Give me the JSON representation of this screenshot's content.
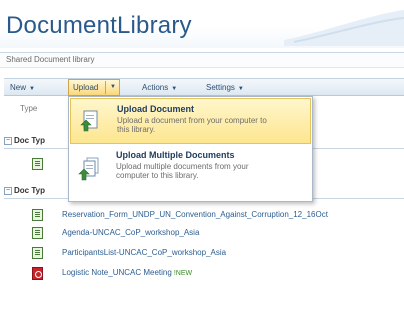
{
  "page_title": "DocumentLibrary",
  "breadcrumb": "Shared Document library",
  "toolbar": {
    "new_label": "New",
    "upload_label": "Upload",
    "actions_label": "Actions",
    "settings_label": "Settings"
  },
  "column_header": "Type",
  "groups": [
    {
      "label": "Doc Typ"
    },
    {
      "label": "Doc Typ"
    }
  ],
  "upload_menu": {
    "items": [
      {
        "title": "Upload Document",
        "description": "Upload a document from your computer to this library.",
        "icon": "upload-document-icon"
      },
      {
        "title": "Upload Multiple Documents",
        "description": "Upload multiple documents from your computer to this library.",
        "icon": "upload-multiple-icon"
      }
    ]
  },
  "documents": [
    {
      "name": "Reservation_Form_UNDP_UN_Convention_Against_Corruption_12_16Oct",
      "icon": "word-document-icon",
      "is_new": false
    },
    {
      "name": "Agenda-UNCAC_CoP_workshop_Asia",
      "icon": "word-document-icon",
      "is_new": false
    },
    {
      "name": "ParticipantsList-UNCAC_CoP_workshop_Asia",
      "icon": "word-document-icon",
      "is_new": false
    },
    {
      "name": "Logistic Note_UNCAC Meeting",
      "icon": "pdf-document-icon",
      "is_new": true,
      "new_label": "!NEW"
    }
  ],
  "colors": {
    "title": "#2a5a8c",
    "link": "#2b5e92",
    "menu_highlight": "#fde68f",
    "toolbar": "#dde8f2"
  }
}
